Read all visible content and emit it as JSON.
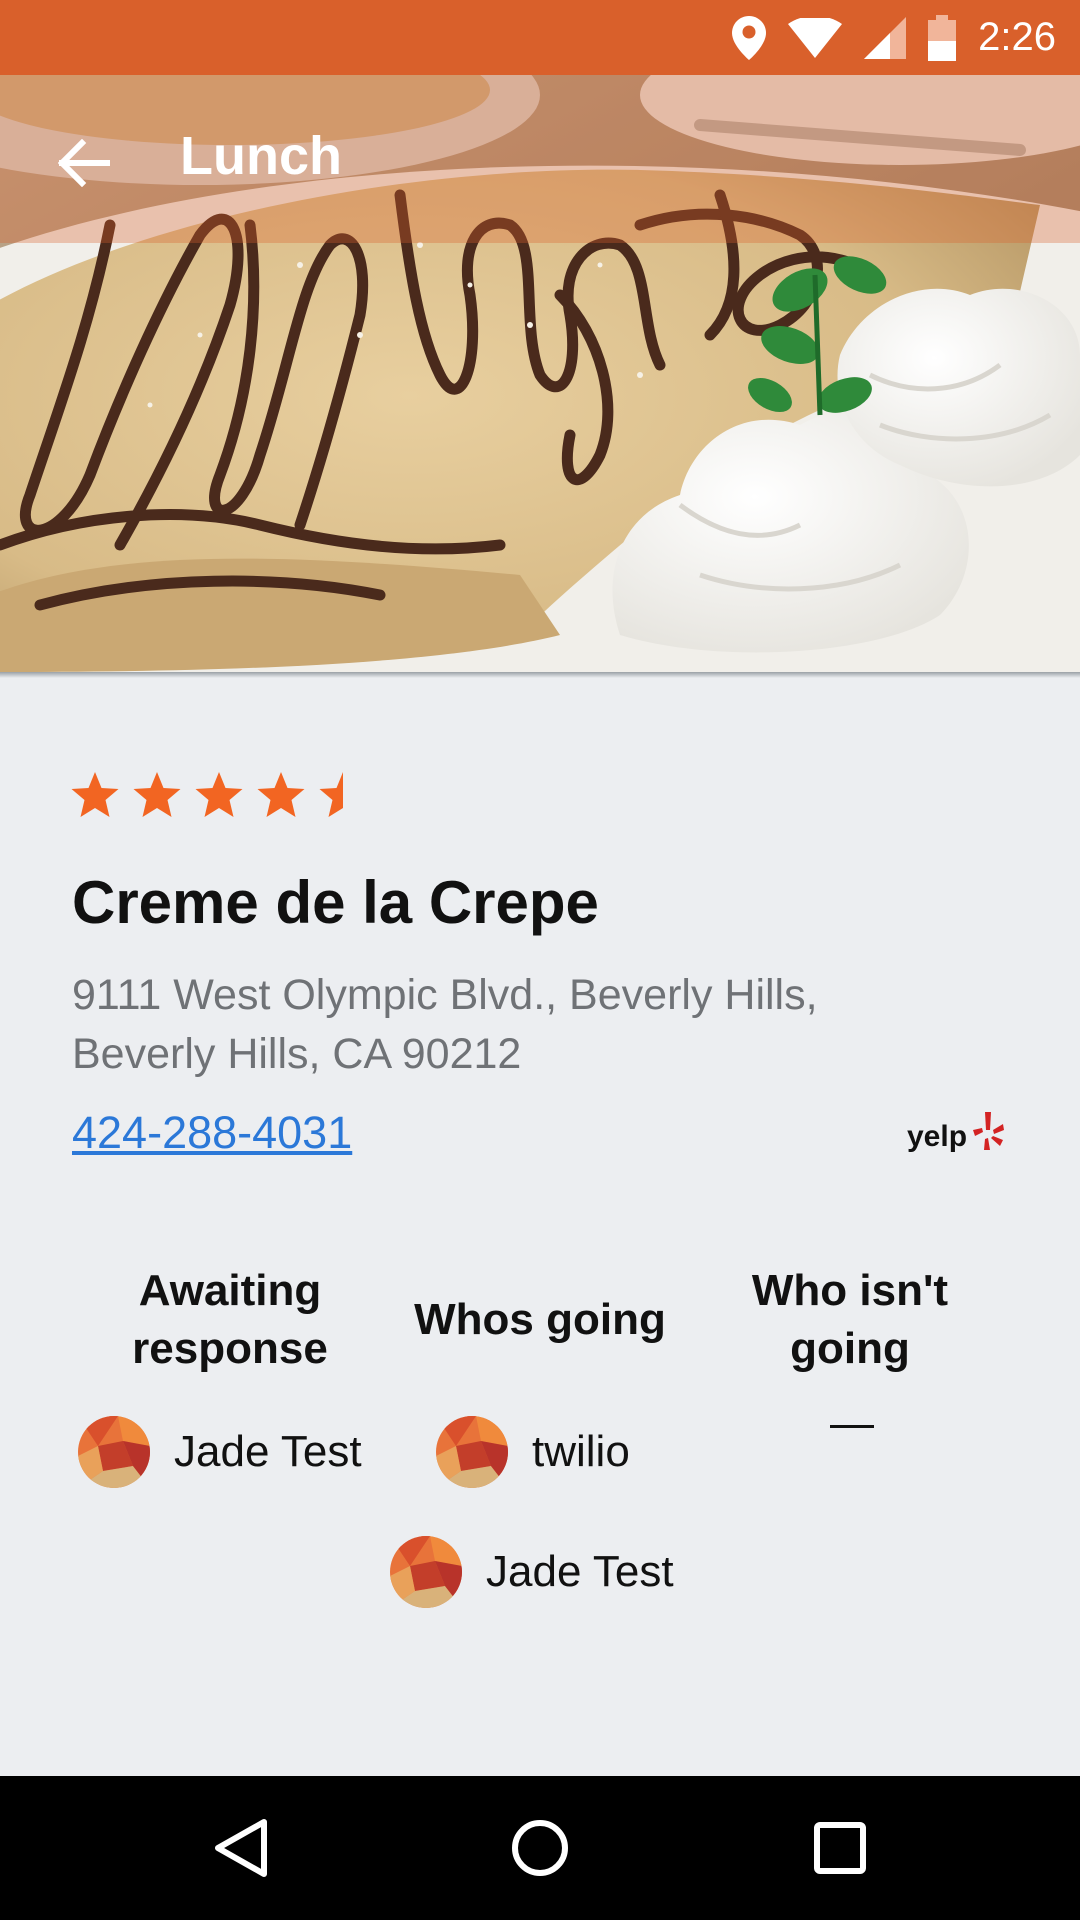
{
  "status_bar": {
    "time": "2:26",
    "icons": [
      "location-icon",
      "wifi-icon",
      "cellular-signal-icon",
      "battery-icon"
    ],
    "color": "#d9602b"
  },
  "toolbar": {
    "title": "Lunch",
    "back_icon": "arrow-back-icon"
  },
  "restaurant": {
    "rating": 4.5,
    "rating_max": 5,
    "name": "Creme de la Crepe",
    "address": "9111 West Olympic Blvd., Beverly Hills, Beverly Hills, CA 90212",
    "phone": "424-288-4031",
    "source_logo": "yelp",
    "accent_color": "#f26522"
  },
  "rsvp": {
    "columns": [
      {
        "heading": "Awaiting response",
        "people": [
          "Jade Test"
        ]
      },
      {
        "heading": "Whos going",
        "people": [
          "twilio",
          "Jade Test"
        ]
      },
      {
        "heading": "Who isn't going",
        "people": [],
        "empty_text": "—"
      }
    ]
  },
  "nav_bar": {
    "icons": [
      "back-triangle-icon",
      "home-circle-icon",
      "recents-square-icon"
    ]
  }
}
